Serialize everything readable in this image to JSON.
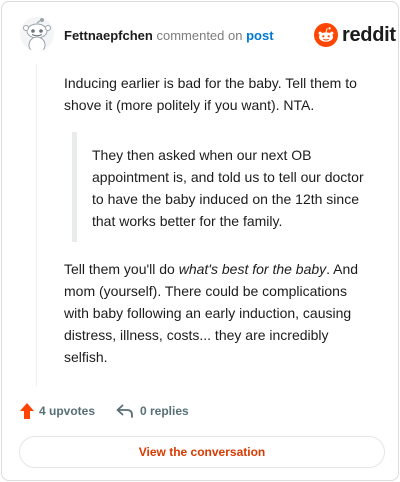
{
  "comment": {
    "author": "Fettnaepfchen",
    "verb": "commented on",
    "target_link": "post",
    "brand": "reddit",
    "paragraph_1": "Inducing earlier is bad for the baby. Tell them to shove it (more politely if you want). NTA.",
    "quote": "They then asked when our next OB appointment is, and told us to tell our doctor to have the baby induced on the 12th since that works better for the family.",
    "paragraph_2_before": "Tell them you'll do ",
    "paragraph_2_emphasis": "what's best for the baby",
    "paragraph_2_after": ". And mom (yourself). There could be complications with baby following an early induction, causing distress, illness, costs... they are incredibly selfish."
  },
  "actions": {
    "upvotes_label": "4 upvotes",
    "replies_label": "0 replies"
  },
  "cta_label": "View the conversation",
  "colors": {
    "accent": "#d93a00",
    "link": "#0079d3",
    "upvote": "#ff4500",
    "muted": "#576f76"
  },
  "icons": [
    "snoo-avatar-icon",
    "reddit-logo-icon",
    "upvote-arrow-icon",
    "reply-arrow-icon"
  ]
}
